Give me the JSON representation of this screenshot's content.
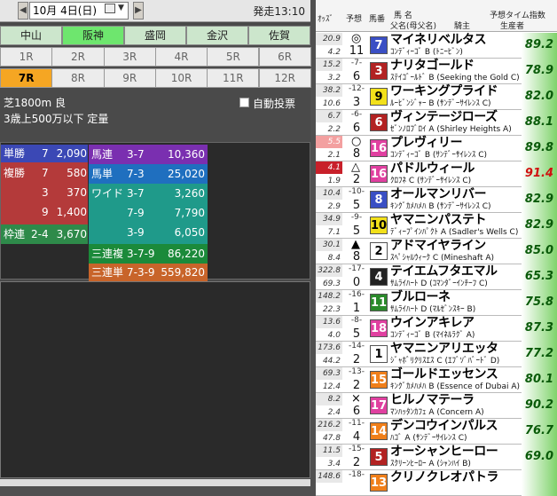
{
  "toolbar": {
    "date": "10月 4日(日)",
    "start_time": "発走13:10"
  },
  "venues": [
    {
      "label": "中山",
      "bg": "#cce6cc"
    },
    {
      "label": "阪神",
      "bg": "#6ee66e"
    },
    {
      "label": "盛岡",
      "bg": "#cce6cc"
    },
    {
      "label": "金沢",
      "bg": "#cce6cc"
    },
    {
      "label": "佐賀",
      "bg": "#cce6cc"
    }
  ],
  "races": [
    "1R",
    "2R",
    "3R",
    "4R",
    "5R",
    "6R",
    "7R",
    "8R",
    "9R",
    "10R",
    "11R",
    "12R"
  ],
  "selected_race": "7R",
  "race_info": {
    "line1": "芝1800m 良",
    "line2": "3歳上500万以下  定量",
    "auto_vote": "自動投票"
  },
  "payouts": {
    "tansho": {
      "label": "単勝",
      "num": "7",
      "amt": "2,090"
    },
    "fukusho": {
      "label": "複勝",
      "rows": [
        {
          "num": "7",
          "amt": "580"
        },
        {
          "num": "3",
          "amt": "370"
        },
        {
          "num": "9",
          "amt": "1,400"
        }
      ]
    },
    "wakuren": {
      "label": "枠連",
      "num": "2-4",
      "amt": "3,670"
    },
    "umaren": {
      "label": "馬連",
      "num": "3-7",
      "amt": "10,360"
    },
    "umatan": {
      "label": "馬単",
      "num": "7-3",
      "amt": "25,020"
    },
    "wide": {
      "label": "ワイド",
      "rows": [
        {
          "num": "3-7",
          "amt": "3,260"
        },
        {
          "num": "7-9",
          "amt": "7,790"
        },
        {
          "num": "3-9",
          "amt": "6,050"
        }
      ]
    },
    "sanrenpuku": {
      "label": "三連複",
      "num": "3-7-9",
      "amt": "86,220"
    },
    "sanrentan": {
      "label": "三連単",
      "num": "7-3-9",
      "amt": "559,820"
    }
  },
  "table_header": {
    "odds": "ｵｯｽﾞ",
    "pred": "予想",
    "umaban": "馬番",
    "name": "馬 名",
    "sire_label": "父名(母父名)",
    "jockey": "騎主",
    "index_label": "予想タイム指数",
    "producer": "生産者"
  },
  "horses": [
    {
      "odds_win": "20.9",
      "odds_place": "4.2",
      "rank": "",
      "pop": "11",
      "mark": "◎",
      "num": "7",
      "num_bg": "#3a4fc4",
      "num_fg": "#fff",
      "name": "マイネリベルタス",
      "sire": "ｺﾝﾃﾞｨｰｺﾞ B (ﾄﾆｰﾋﾞﾝ)",
      "idx": "89.2",
      "odds_hl": ""
    },
    {
      "odds_win": "15.2",
      "odds_place": "3.2",
      "rank": "-7-",
      "pop": "6",
      "mark": "",
      "num": "3",
      "num_bg": "#b22222",
      "num_fg": "#fff",
      "name": "ナリタゴールド",
      "sire": "ｽﾃｲｺﾞｰﾙﾄﾞ B (Seeking the Gold C)",
      "idx": "78.9",
      "odds_hl": ""
    },
    {
      "odds_win": "38.2",
      "odds_place": "10.6",
      "rank": "-12-",
      "pop": "3",
      "mark": "",
      "num": "9",
      "num_bg": "#f2e01a",
      "num_fg": "#000",
      "name": "ワーキングプライド",
      "sire": "ﾙｰﾋﾞﾝｼﾞｬｰ B (ｻﾝﾃﾞｰｻｲﾚﾝｽ C)",
      "idx": "82.0",
      "odds_hl": ""
    },
    {
      "odds_win": "6.7",
      "odds_place": "2.2",
      "rank": "-6-",
      "pop": "6",
      "mark": "",
      "num": "6",
      "num_bg": "#b22222",
      "num_fg": "#fff",
      "name": "ヴィンテージローズ",
      "sire": "ｾﾞﾝﾉﾛﾌﾞﾛｲ A (Shirley Heights A)",
      "idx": "88.1",
      "odds_hl": ""
    },
    {
      "odds_win": "5.5",
      "odds_place": "2.1",
      "rank": "",
      "pop": "8",
      "mark": "○",
      "num": "16",
      "num_bg": "#e040a0",
      "num_fg": "#fff",
      "name": "プレヴィリー",
      "sire": "ｺﾝﾃﾞｨｰｺﾞ B (ｻﾝﾃﾞｰｻｲﾚﾝｽ C)",
      "idx": "89.8",
      "odds_hl": "pink"
    },
    {
      "odds_win": "4.1",
      "odds_place": "1.9",
      "rank": "",
      "pop": "2",
      "mark": "△",
      "num": "16",
      "num_bg": "#e040a0",
      "num_fg": "#fff",
      "name": "パドルウィール",
      "sire": "ｸﾛﾌﾈ C (ｻﾝﾃﾞｰｻｲﾚﾝｽ C)",
      "idx": "91.4",
      "odds_hl": "red"
    },
    {
      "odds_win": "10.4",
      "odds_place": "2.9",
      "rank": "-10-",
      "pop": "5",
      "mark": "",
      "num": "8",
      "num_bg": "#3a4fc4",
      "num_fg": "#fff",
      "name": "オールマンリバー",
      "sire": "ｷﾝｸﾞｶﾒﾊﾒﾊ B (ｻﾝﾃﾞｰｻｲﾚﾝｽ C)",
      "idx": "82.9",
      "odds_hl": ""
    },
    {
      "odds_win": "34.9",
      "odds_place": "7.1",
      "rank": "-9-",
      "pop": "5",
      "mark": "",
      "num": "10",
      "num_bg": "#f2e01a",
      "num_fg": "#000",
      "name": "ヤマニンパステト",
      "sire": "ﾃﾞｨｰﾌﾟｲﾝﾊﾟｸﾄ A (Sadler's Wells C)",
      "idx": "82.9",
      "odds_hl": ""
    },
    {
      "odds_win": "30.1",
      "odds_place": "8.4",
      "rank": "",
      "pop": "8",
      "mark": "▲",
      "num": "2",
      "num_bg": "#ffffff",
      "num_fg": "#000",
      "name": "アドマイヤライン",
      "sire": "ｽﾍﾟｼｬﾙｳｨｰｸ C (Mineshaft A)",
      "idx": "85.0",
      "odds_hl": ""
    },
    {
      "odds_win": "322.8",
      "odds_place": "69.3",
      "rank": "-17-",
      "pop": "0",
      "mark": "",
      "num": "4",
      "num_bg": "#222222",
      "num_fg": "#fff",
      "name": "テイエムフタエマル",
      "sire": "ｻﾑﾗｲﾊｰﾄ D (ｺﾏﾝﾀﾞｰｲﾝﾁｰﾌ C)",
      "idx": "65.3",
      "odds_hl": ""
    },
    {
      "odds_win": "148.2",
      "odds_place": "22.3",
      "rank": "-16-",
      "pop": "1",
      "mark": "",
      "num": "11",
      "num_bg": "#2a8a2a",
      "num_fg": "#fff",
      "name": "ブルローネ",
      "sire": "ｻﾑﾗｲﾊｰﾄ D (ﾏﾙｾﾞﾝｽｷｰ B)",
      "idx": "75.8",
      "odds_hl": ""
    },
    {
      "odds_win": "13.6",
      "odds_place": "4.0",
      "rank": "-8-",
      "pop": "5",
      "mark": "",
      "num": "18",
      "num_bg": "#e040a0",
      "num_fg": "#fff",
      "name": "ウインアキレア",
      "sire": "ｺﾝﾃﾞｨｰｺﾞ B (ﾏｲﾈﾙﾗｸﾞ A)",
      "idx": "87.3",
      "odds_hl": ""
    },
    {
      "odds_win": "173.6",
      "odds_place": "44.2",
      "rank": "-14-",
      "pop": "2",
      "mark": "",
      "num": "1",
      "num_bg": "#ffffff",
      "num_fg": "#000",
      "name": "ヤマニンアリエッタ",
      "sire": "ｼﾞｬﾎﾞﾘｸﾘｽｴｽ C (ｴﾌﾞｿﾞﾊﾞｰﾄﾞ D)",
      "idx": "77.2",
      "odds_hl": ""
    },
    {
      "odds_win": "69.3",
      "odds_place": "12.4",
      "rank": "-13-",
      "pop": "2",
      "mark": "",
      "num": "15",
      "num_bg": "#f07f1a",
      "num_fg": "#fff",
      "name": "ゴールドエッセンス",
      "sire": "ｷﾝｸﾞｶﾒﾊﾒﾊ B (Essence of Dubai A)",
      "idx": "80.1",
      "odds_hl": ""
    },
    {
      "odds_win": "8.2",
      "odds_place": "2.4",
      "rank": "",
      "pop": "6",
      "mark": "×",
      "num": "17",
      "num_bg": "#e040a0",
      "num_fg": "#fff",
      "name": "ヒルノマテーラ",
      "sire": "ﾏﾝﾊｯﾀﾝｶﾌｪ A (Concern A)",
      "idx": "90.2",
      "odds_hl": ""
    },
    {
      "odds_win": "216.2",
      "odds_place": "47.8",
      "rank": "-11-",
      "pop": "4",
      "mark": "",
      "num": "14",
      "num_bg": "#f07f1a",
      "num_fg": "#fff",
      "name": "デンコウインパルス",
      "sire": "ﾊｺﾞ A (ｻﾝﾃﾞｰｻｲﾚﾝｽ C)",
      "idx": "76.7",
      "odds_hl": ""
    },
    {
      "odds_win": "11.5",
      "odds_place": "3.4",
      "rank": "-15-",
      "pop": "2",
      "mark": "",
      "num": "5",
      "num_bg": "#b22222",
      "num_fg": "#fff",
      "name": "オーシャンヒーロー",
      "sire": "ｽｸﾘｰﾝﾋｰﾛｰ A (ｼｬﾝﾊｲ B)",
      "idx": "69.0",
      "odds_hl": ""
    },
    {
      "odds_win": "148.6",
      "odds_place": "",
      "rank": "-18-",
      "pop": "",
      "mark": "",
      "num": "13",
      "num_bg": "#f07f1a",
      "num_fg": "#fff",
      "name": "クリノクレオパトラ",
      "sire": "",
      "idx": "",
      "odds_hl": ""
    }
  ]
}
